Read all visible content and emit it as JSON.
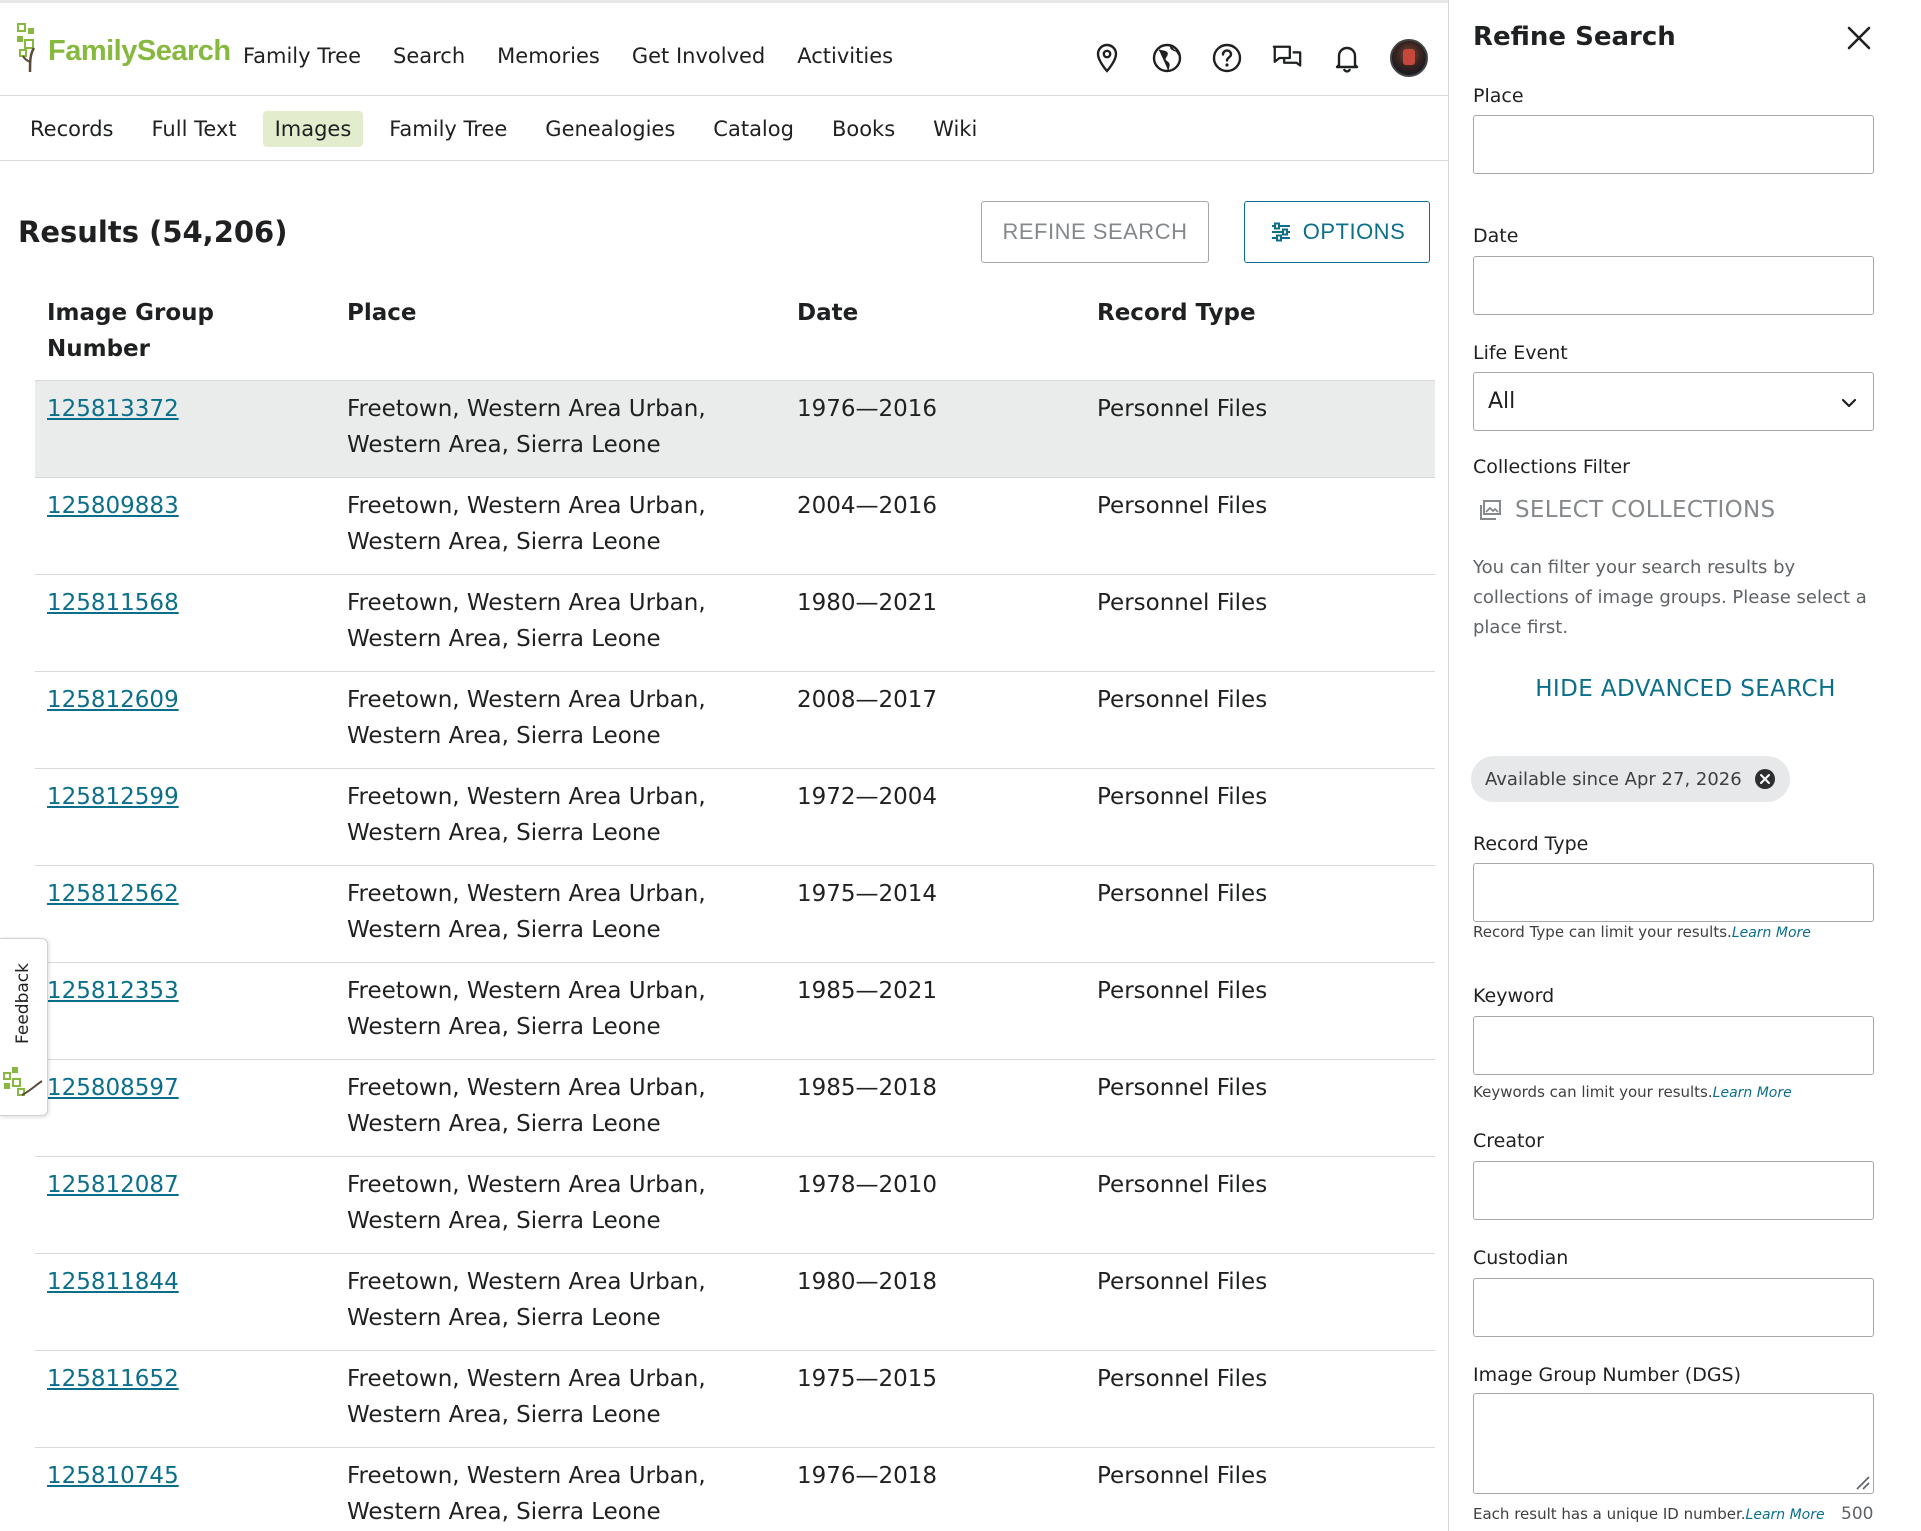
{
  "brand": {
    "name": "FamilySearch",
    "accent": "#87b940",
    "link": "#0b6f8c"
  },
  "primary_nav": [
    {
      "label": "Family Tree"
    },
    {
      "label": "Search"
    },
    {
      "label": "Memories"
    },
    {
      "label": "Get Involved"
    },
    {
      "label": "Activities"
    }
  ],
  "header_icons": [
    "location-pin-icon",
    "globe-icon",
    "help-icon",
    "chat-icon",
    "bell-icon"
  ],
  "sub_nav": [
    {
      "label": "Records"
    },
    {
      "label": "Full Text"
    },
    {
      "label": "Images",
      "active": true
    },
    {
      "label": "Family Tree"
    },
    {
      "label": "Genealogies"
    },
    {
      "label": "Catalog"
    },
    {
      "label": "Books"
    },
    {
      "label": "Wiki"
    }
  ],
  "results": {
    "title": "Results (54,206)",
    "refine_label": "REFINE SEARCH",
    "options_label": "OPTIONS",
    "columns": [
      "Image Group Number",
      "Place",
      "Date",
      "Record Type"
    ],
    "rows": [
      {
        "id": "125813372",
        "place": "Freetown, Western Area Urban, Western Area, Sierra Leone",
        "date": "1976—2016",
        "type": "Personnel Files"
      },
      {
        "id": "125809883",
        "place": "Freetown, Western Area Urban, Western Area, Sierra Leone",
        "date": "2004—2016",
        "type": "Personnel Files"
      },
      {
        "id": "125811568",
        "place": "Freetown, Western Area Urban, Western Area, Sierra Leone",
        "date": "1980—2021",
        "type": "Personnel Files"
      },
      {
        "id": "125812609",
        "place": "Freetown, Western Area Urban, Western Area, Sierra Leone",
        "date": "2008—2017",
        "type": "Personnel Files"
      },
      {
        "id": "125812599",
        "place": "Freetown, Western Area Urban, Western Area, Sierra Leone",
        "date": "1972—2004",
        "type": "Personnel Files"
      },
      {
        "id": "125812562",
        "place": "Freetown, Western Area Urban, Western Area, Sierra Leone",
        "date": "1975—2014",
        "type": "Personnel Files"
      },
      {
        "id": "125812353",
        "place": "Freetown, Western Area Urban, Western Area, Sierra Leone",
        "date": "1985—2021",
        "type": "Personnel Files"
      },
      {
        "id": "125808597",
        "place": "Freetown, Western Area Urban, Western Area, Sierra Leone",
        "date": "1985—2018",
        "type": "Personnel Files"
      },
      {
        "id": "125812087",
        "place": "Freetown, Western Area Urban, Western Area, Sierra Leone",
        "date": "1978—2010",
        "type": "Personnel Files"
      },
      {
        "id": "125811844",
        "place": "Freetown, Western Area Urban, Western Area, Sierra Leone",
        "date": "1980—2018",
        "type": "Personnel Files"
      },
      {
        "id": "125811652",
        "place": "Freetown, Western Area Urban, Western Area, Sierra Leone",
        "date": "1975—2015",
        "type": "Personnel Files"
      },
      {
        "id": "125810745",
        "place": "Freetown, Western Area Urban, Western Area, Sierra Leone",
        "date": "1976—2018",
        "type": "Personnel Files"
      }
    ]
  },
  "feedback": {
    "label": "Feedback"
  },
  "panel": {
    "title": "Refine Search",
    "place_label": "Place",
    "place_value": "",
    "date_label": "Date",
    "date_value": "",
    "life_event_label": "Life Event",
    "life_event_value": "All",
    "collections_label": "Collections Filter",
    "select_collections": "SELECT COLLECTIONS",
    "collections_help": "You can filter your search results by collections of image groups. Please select a place first.",
    "hide_advanced": "HIDE ADVANCED SEARCH",
    "chip": "Available since Apr 27, 2026",
    "record_type_label": "Record Type",
    "record_type_help": "Record Type can limit your results.",
    "keyword_label": "Keyword",
    "keyword_help": "Keywords can limit your results.",
    "creator_label": "Creator",
    "custodian_label": "Custodian",
    "dgs_label": "Image Group Number (DGS)",
    "dgs_help": "Each result has a unique ID number.",
    "learn_more": "Learn More",
    "char_count": "500"
  }
}
